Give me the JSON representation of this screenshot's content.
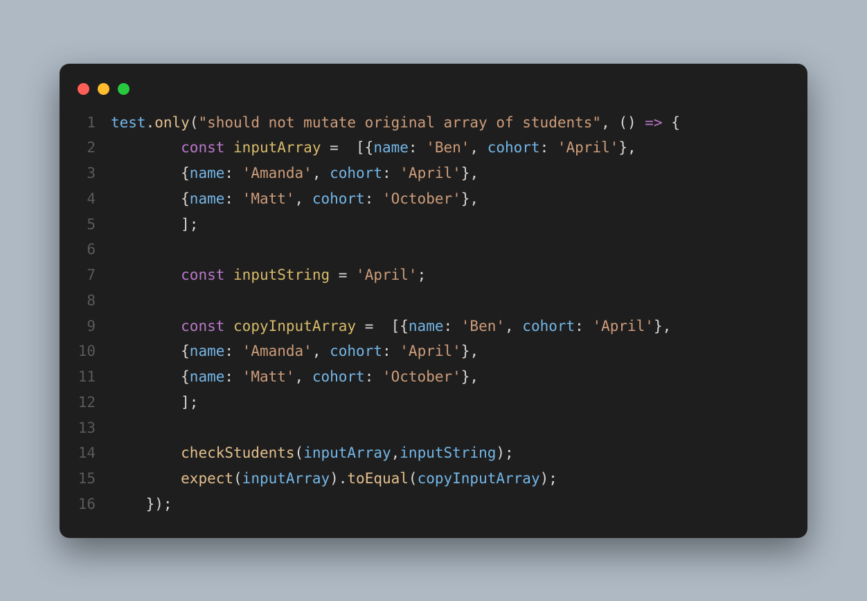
{
  "colors": {
    "background": "#aeb9c4",
    "window": "#1f1e1e",
    "dot_red": "#ff5f56",
    "dot_yellow": "#ffbd2e",
    "dot_green": "#27c93f",
    "lineno": "#5a5a5a",
    "default": "#d8d8d5",
    "fn": "#73b7e8",
    "method": "#e2c08d",
    "string": "#cd9d7b",
    "keyword": "#b879c9",
    "variable": "#d7bb6b"
  },
  "code": {
    "line_numbers": [
      "1",
      "2",
      "3",
      "4",
      "5",
      "6",
      "7",
      "8",
      "9",
      "10",
      "11",
      "12",
      "13",
      "14",
      "15",
      "16"
    ],
    "lines": [
      [
        {
          "c": "fn",
          "t": "test"
        },
        {
          "c": "punc",
          "t": "."
        },
        {
          "c": "method",
          "t": "only"
        },
        {
          "c": "punc",
          "t": "("
        },
        {
          "c": "str",
          "t": "\"should not mutate original array of students\""
        },
        {
          "c": "punc",
          "t": ", () "
        },
        {
          "c": "arrow",
          "t": "=>"
        },
        {
          "c": "punc",
          "t": " {"
        }
      ],
      [
        {
          "c": "punc",
          "t": "        "
        },
        {
          "c": "kw",
          "t": "const"
        },
        {
          "c": "punc",
          "t": " "
        },
        {
          "c": "var",
          "t": "inputArray"
        },
        {
          "c": "punc",
          "t": " =  [{"
        },
        {
          "c": "key",
          "t": "name"
        },
        {
          "c": "punc",
          "t": ": "
        },
        {
          "c": "str",
          "t": "'Ben'"
        },
        {
          "c": "punc",
          "t": ", "
        },
        {
          "c": "key",
          "t": "cohort"
        },
        {
          "c": "punc",
          "t": ": "
        },
        {
          "c": "str",
          "t": "'April'"
        },
        {
          "c": "punc",
          "t": "},"
        }
      ],
      [
        {
          "c": "punc",
          "t": "        {"
        },
        {
          "c": "key",
          "t": "name"
        },
        {
          "c": "punc",
          "t": ": "
        },
        {
          "c": "str",
          "t": "'Amanda'"
        },
        {
          "c": "punc",
          "t": ", "
        },
        {
          "c": "key",
          "t": "cohort"
        },
        {
          "c": "punc",
          "t": ": "
        },
        {
          "c": "str",
          "t": "'April'"
        },
        {
          "c": "punc",
          "t": "},"
        }
      ],
      [
        {
          "c": "punc",
          "t": "        {"
        },
        {
          "c": "key",
          "t": "name"
        },
        {
          "c": "punc",
          "t": ": "
        },
        {
          "c": "str",
          "t": "'Matt'"
        },
        {
          "c": "punc",
          "t": ", "
        },
        {
          "c": "key",
          "t": "cohort"
        },
        {
          "c": "punc",
          "t": ": "
        },
        {
          "c": "str",
          "t": "'October'"
        },
        {
          "c": "punc",
          "t": "},"
        }
      ],
      [
        {
          "c": "punc",
          "t": "        ];"
        }
      ],
      [
        {
          "c": "punc",
          "t": ""
        }
      ],
      [
        {
          "c": "punc",
          "t": "        "
        },
        {
          "c": "kw",
          "t": "const"
        },
        {
          "c": "punc",
          "t": " "
        },
        {
          "c": "var",
          "t": "inputString"
        },
        {
          "c": "punc",
          "t": " = "
        },
        {
          "c": "str",
          "t": "'April'"
        },
        {
          "c": "punc",
          "t": ";"
        }
      ],
      [
        {
          "c": "punc",
          "t": ""
        }
      ],
      [
        {
          "c": "punc",
          "t": "        "
        },
        {
          "c": "kw",
          "t": "const"
        },
        {
          "c": "punc",
          "t": " "
        },
        {
          "c": "var",
          "t": "copyInputArray"
        },
        {
          "c": "punc",
          "t": " =  [{"
        },
        {
          "c": "key",
          "t": "name"
        },
        {
          "c": "punc",
          "t": ": "
        },
        {
          "c": "str",
          "t": "'Ben'"
        },
        {
          "c": "punc",
          "t": ", "
        },
        {
          "c": "key",
          "t": "cohort"
        },
        {
          "c": "punc",
          "t": ": "
        },
        {
          "c": "str",
          "t": "'April'"
        },
        {
          "c": "punc",
          "t": "},"
        }
      ],
      [
        {
          "c": "punc",
          "t": "        {"
        },
        {
          "c": "key",
          "t": "name"
        },
        {
          "c": "punc",
          "t": ": "
        },
        {
          "c": "str",
          "t": "'Amanda'"
        },
        {
          "c": "punc",
          "t": ", "
        },
        {
          "c": "key",
          "t": "cohort"
        },
        {
          "c": "punc",
          "t": ": "
        },
        {
          "c": "str",
          "t": "'April'"
        },
        {
          "c": "punc",
          "t": "},"
        }
      ],
      [
        {
          "c": "punc",
          "t": "        {"
        },
        {
          "c": "key",
          "t": "name"
        },
        {
          "c": "punc",
          "t": ": "
        },
        {
          "c": "str",
          "t": "'Matt'"
        },
        {
          "c": "punc",
          "t": ", "
        },
        {
          "c": "key",
          "t": "cohort"
        },
        {
          "c": "punc",
          "t": ": "
        },
        {
          "c": "str",
          "t": "'October'"
        },
        {
          "c": "punc",
          "t": "},"
        }
      ],
      [
        {
          "c": "punc",
          "t": "        ];"
        }
      ],
      [
        {
          "c": "punc",
          "t": ""
        }
      ],
      [
        {
          "c": "punc",
          "t": "        "
        },
        {
          "c": "method",
          "t": "checkStudents"
        },
        {
          "c": "punc",
          "t": "("
        },
        {
          "c": "fn",
          "t": "inputArray"
        },
        {
          "c": "punc",
          "t": ","
        },
        {
          "c": "fn",
          "t": "inputString"
        },
        {
          "c": "punc",
          "t": ");"
        }
      ],
      [
        {
          "c": "punc",
          "t": "        "
        },
        {
          "c": "method",
          "t": "expect"
        },
        {
          "c": "punc",
          "t": "("
        },
        {
          "c": "fn",
          "t": "inputArray"
        },
        {
          "c": "punc",
          "t": ")."
        },
        {
          "c": "method",
          "t": "toEqual"
        },
        {
          "c": "punc",
          "t": "("
        },
        {
          "c": "fn",
          "t": "copyInputArray"
        },
        {
          "c": "punc",
          "t": ");"
        }
      ],
      [
        {
          "c": "punc",
          "t": "    });"
        }
      ]
    ]
  }
}
